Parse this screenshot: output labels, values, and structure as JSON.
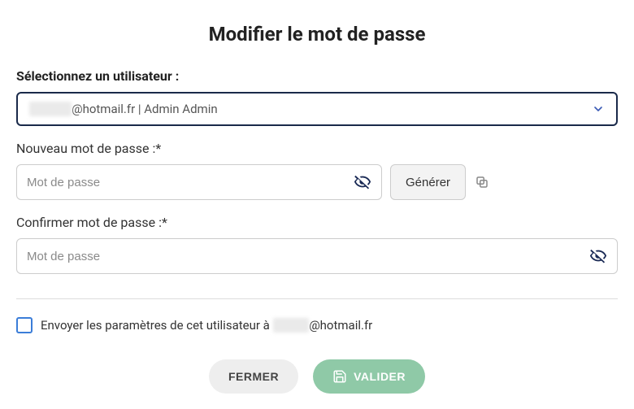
{
  "title": "Modifier le mot de passe",
  "user_select": {
    "label": "Sélectionnez un utilisateur :",
    "redacted_prefix": "xxxxxxx",
    "value_suffix": "@hotmail.fr | Admin Admin"
  },
  "new_password": {
    "label": "Nouveau mot de passe :*",
    "placeholder": "Mot de passe",
    "generate_label": "Générer"
  },
  "confirm_password": {
    "label": "Confirmer mot de passe :*",
    "placeholder": "Mot de passe"
  },
  "send_params": {
    "label_prefix": "Envoyer les paramètres de cet utilisateur à ",
    "redacted_email_local": "xxxxxx",
    "email_domain": "@hotmail.fr"
  },
  "actions": {
    "close": "FERMER",
    "validate": "VALIDER"
  }
}
